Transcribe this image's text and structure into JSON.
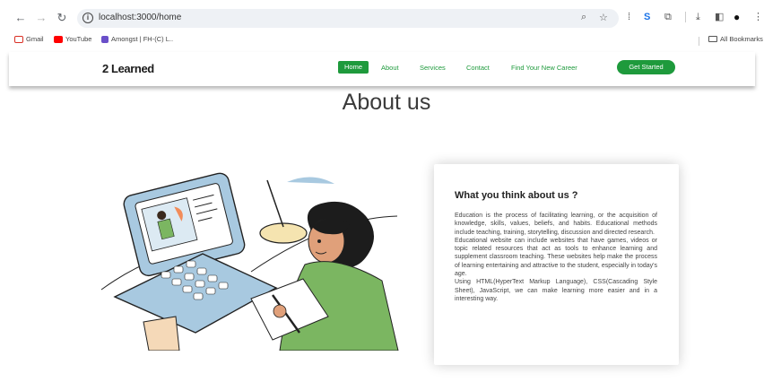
{
  "browser": {
    "url": "localhost:3000/home",
    "bookmarks": [
      {
        "label": "Gmail",
        "color": "#d93025"
      },
      {
        "label": "YouTube",
        "color": "#ff0000"
      },
      {
        "label": "Amongst | FH-(C) L..",
        "color": "#6a4fc9"
      }
    ],
    "all_bookmarks_label": "All Bookmarks"
  },
  "site": {
    "logo": "2 Learned",
    "nav": {
      "home": "Home",
      "about": "About",
      "services": "Services",
      "contact": "Contact",
      "career": "Find Your New Career"
    },
    "cta": "Get Started",
    "accent_color": "#1e9a3c"
  },
  "main": {
    "title": "About us",
    "card": {
      "heading": "What you think about us ?",
      "paragraphs": [
        "Education is the process of facilitating learning, or the acquisition of knowledge, skills, values, beliefs, and habits. Educational methods include teaching, training, storytelling, discussion and directed research.",
        "Educational website can include websites that have games, videos or topic related resources that act as tools to enhance learning and supplement classroom teaching. These websites help make the process of learning entertaining and attractive to the student, especially in today's age.",
        "Using HTML(HyperText Markup Language), CSS(Cascading Style Sheet), JavaScript, we can make learning more easier and in a interesting way."
      ]
    }
  }
}
